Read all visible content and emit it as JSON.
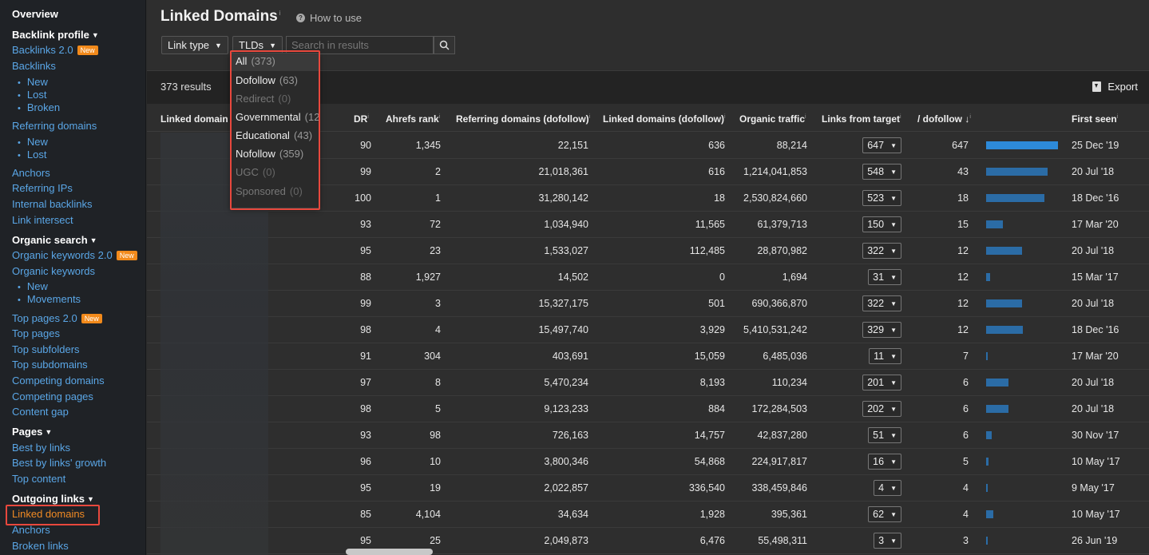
{
  "sidebar": {
    "overview": "Overview",
    "backlink_profile": "Backlink profile",
    "backlinks2": "Backlinks 2.0",
    "new_badge": "New",
    "backlinks": "Backlinks",
    "bl_new": "New",
    "bl_lost": "Lost",
    "bl_broken": "Broken",
    "referring_domains": "Referring domains",
    "rd_new": "New",
    "rd_lost": "Lost",
    "anchors": "Anchors",
    "referring_ips": "Referring IPs",
    "internal_backlinks": "Internal backlinks",
    "link_intersect": "Link intersect",
    "organic_search": "Organic search",
    "organic_keywords2": "Organic keywords 2.0",
    "organic_keywords": "Organic keywords",
    "ok_new": "New",
    "ok_movements": "Movements",
    "top_pages2": "Top pages 2.0",
    "top_pages": "Top pages",
    "top_subfolders": "Top subfolders",
    "top_subdomains": "Top subdomains",
    "competing_domains": "Competing domains",
    "competing_pages": "Competing pages",
    "content_gap": "Content gap",
    "pages": "Pages",
    "best_by_links": "Best by links",
    "best_by_links_growth": "Best by links' growth",
    "top_content": "Top content",
    "outgoing_links": "Outgoing links",
    "linked_domains": "Linked domains",
    "out_anchors": "Anchors",
    "broken_links": "Broken links"
  },
  "header": {
    "title": "Linked Domains",
    "how_to_use": "How to use"
  },
  "filters": {
    "link_type": "Link type",
    "tlds": "TLDs",
    "search_placeholder": "Search in results"
  },
  "results": {
    "count": "373 results",
    "export": "Export"
  },
  "tld_menu": [
    {
      "label": "All",
      "count": "(373)",
      "disabled": false
    },
    {
      "label": "Dofollow",
      "count": "(63)",
      "disabled": false
    },
    {
      "label": "Redirect",
      "count": "(0)",
      "disabled": true
    },
    {
      "label": "Governmental",
      "count": "(12",
      "disabled": false
    },
    {
      "label": "Educational",
      "count": "(43)",
      "disabled": false
    },
    {
      "label": "Nofollow",
      "count": "(359)",
      "disabled": false
    },
    {
      "label": "UGC",
      "count": "(0)",
      "disabled": true
    },
    {
      "label": "Sponsored",
      "count": "(0)",
      "disabled": true
    }
  ],
  "columns": {
    "linked_domain": "Linked domain",
    "dr": "DR",
    "ahrefs_rank": "Ahrefs rank",
    "ref_domains": "Referring domains (dofollow)",
    "linked_domains": "Linked domains (dofollow)",
    "organic_traffic": "Organic traffic",
    "links_from_target": "Links from target",
    "dofollow": "/ dofollow",
    "first_seen": "First seen"
  },
  "rows": [
    {
      "dr": "90",
      "rank": "1,345",
      "ref": "22,151",
      "linked": "636",
      "traffic": "88,214",
      "links": "647",
      "dofollow": "647",
      "fraction": 1.0,
      "first_seen": "25 Dec '19"
    },
    {
      "dr": "99",
      "rank": "2",
      "ref": "21,018,361",
      "linked": "616",
      "traffic": "1,214,041,853",
      "links": "548",
      "dofollow": "43",
      "fraction": 0.85,
      "first_seen": "20 Jul '18"
    },
    {
      "dr": "100",
      "rank": "1",
      "ref": "31,280,142",
      "linked": "18",
      "traffic": "2,530,824,660",
      "links": "523",
      "dofollow": "18",
      "fraction": 0.81,
      "first_seen": "18 Dec '16"
    },
    {
      "dr": "93",
      "rank": "72",
      "ref": "1,034,940",
      "linked": "11,565",
      "traffic": "61,379,713",
      "links": "150",
      "dofollow": "15",
      "fraction": 0.23,
      "first_seen": "17 Mar '20"
    },
    {
      "dr": "95",
      "rank": "23",
      "ref": "1,533,027",
      "linked": "112,485",
      "traffic": "28,870,982",
      "links": "322",
      "dofollow": "12",
      "fraction": 0.5,
      "first_seen": "20 Jul '18"
    },
    {
      "dr": "88",
      "rank": "1,927",
      "ref": "14,502",
      "linked": "0",
      "traffic": "1,694",
      "links": "31",
      "dofollow": "12",
      "fraction": 0.05,
      "first_seen": "15 Mar '17"
    },
    {
      "dr": "99",
      "rank": "3",
      "ref": "15,327,175",
      "linked": "501",
      "traffic": "690,366,870",
      "links": "322",
      "dofollow": "12",
      "fraction": 0.5,
      "first_seen": "20 Jul '18"
    },
    {
      "dr": "98",
      "rank": "4",
      "ref": "15,497,740",
      "linked": "3,929",
      "traffic": "5,410,531,242",
      "links": "329",
      "dofollow": "12",
      "fraction": 0.51,
      "first_seen": "18 Dec '16"
    },
    {
      "dr": "91",
      "rank": "304",
      "ref": "403,691",
      "linked": "15,059",
      "traffic": "6,485,036",
      "links": "11",
      "dofollow": "7",
      "fraction": 0.02,
      "first_seen": "17 Mar '20"
    },
    {
      "dr": "97",
      "rank": "8",
      "ref": "5,470,234",
      "linked": "8,193",
      "traffic": "110,234",
      "links": "201",
      "dofollow": "6",
      "fraction": 0.31,
      "first_seen": "20 Jul '18"
    },
    {
      "dr": "98",
      "rank": "5",
      "ref": "9,123,233",
      "linked": "884",
      "traffic": "172,284,503",
      "links": "202",
      "dofollow": "6",
      "fraction": 0.31,
      "first_seen": "20 Jul '18"
    },
    {
      "dr": "93",
      "rank": "98",
      "ref": "726,163",
      "linked": "14,757",
      "traffic": "42,837,280",
      "links": "51",
      "dofollow": "6",
      "fraction": 0.08,
      "first_seen": "30 Nov '17"
    },
    {
      "dr": "96",
      "rank": "10",
      "ref": "3,800,346",
      "linked": "54,868",
      "traffic": "224,917,817",
      "links": "16",
      "dofollow": "5",
      "fraction": 0.03,
      "first_seen": "10 May '17"
    },
    {
      "dr": "95",
      "rank": "19",
      "ref": "2,022,857",
      "linked": "336,540",
      "traffic": "338,459,846",
      "links": "4",
      "dofollow": "4",
      "fraction": 0.01,
      "first_seen": "9 May '17"
    },
    {
      "dr": "85",
      "rank": "4,104",
      "ref": "34,634",
      "linked": "1,928",
      "traffic": "395,361",
      "links": "62",
      "dofollow": "4",
      "fraction": 0.1,
      "first_seen": "10 May '17"
    },
    {
      "dr": "95",
      "rank": "25",
      "ref": "2,049,873",
      "linked": "6,476",
      "traffic": "55,498,311",
      "links": "3",
      "dofollow": "3",
      "fraction": 0.01,
      "first_seen": "26 Jun '19"
    }
  ]
}
